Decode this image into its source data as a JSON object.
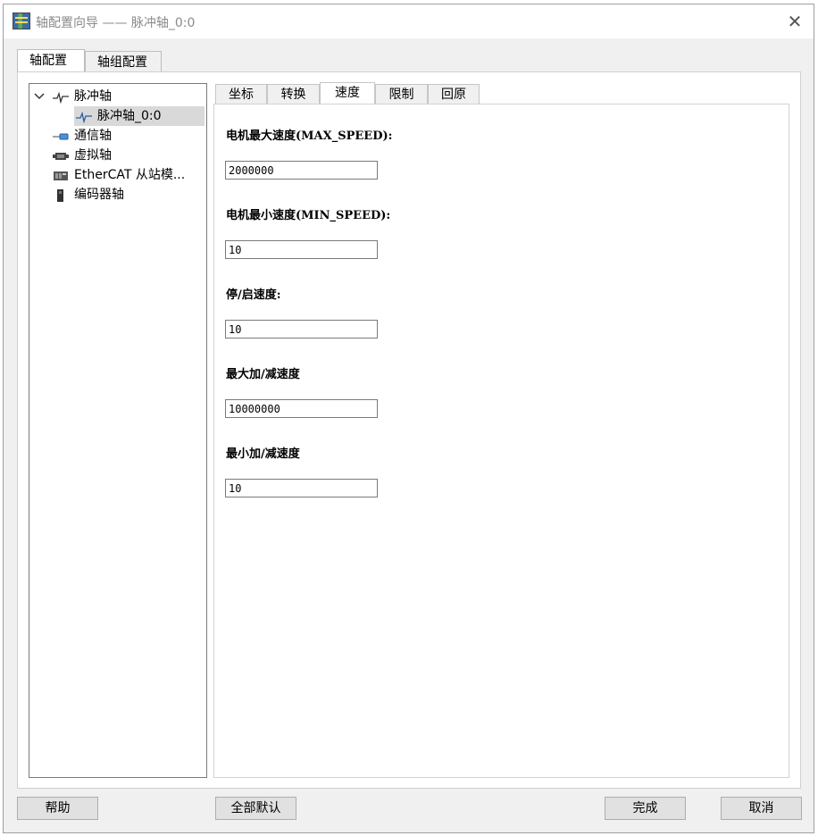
{
  "window": {
    "title": "轴配置向导 —— 脉冲轴_0:0",
    "close_glyph": "✕"
  },
  "outer_tabs": [
    {
      "label": "轴配置",
      "active": true
    },
    {
      "label": "轴组配置",
      "active": false
    }
  ],
  "tree": {
    "items": [
      {
        "label": "脉冲轴",
        "icon": "pulse-wave-icon",
        "expanded": true
      },
      {
        "label": "脉冲轴_0:0",
        "icon": "pulse-wave-icon",
        "selected": true
      },
      {
        "label": "通信轴",
        "icon": "plug-connector-icon"
      },
      {
        "label": "虚拟轴",
        "icon": "virtual-motor-icon"
      },
      {
        "label": "EtherCAT 从站模...",
        "icon": "ethercat-device-icon"
      },
      {
        "label": "编码器轴",
        "icon": "encoder-icon"
      }
    ]
  },
  "inner_tabs": [
    {
      "label": "坐标",
      "active": false
    },
    {
      "label": "转换",
      "active": false
    },
    {
      "label": "速度",
      "active": true
    },
    {
      "label": "限制",
      "active": false
    },
    {
      "label": "回原",
      "active": false
    }
  ],
  "speed": {
    "max_speed_label": "电机最大速度(MAX_SPEED):",
    "max_speed_value": "2000000",
    "min_speed_label": "电机最小速度(MIN_SPEED):",
    "min_speed_value": "10",
    "start_stop_label": "停/启速度:",
    "start_stop_value": "10",
    "max_acc_label": "最大加/减速度",
    "max_acc_value": "10000000",
    "min_acc_label": "最小加/减速度",
    "min_acc_value": "10"
  },
  "buttons": {
    "help": "帮助",
    "all_default": "全部默认",
    "finish": "完成",
    "cancel": "取消"
  },
  "colors": {
    "window_bg": "#f0f0f0",
    "selection_bg": "#d9d9d9",
    "title_text": "#8a8a8a"
  }
}
